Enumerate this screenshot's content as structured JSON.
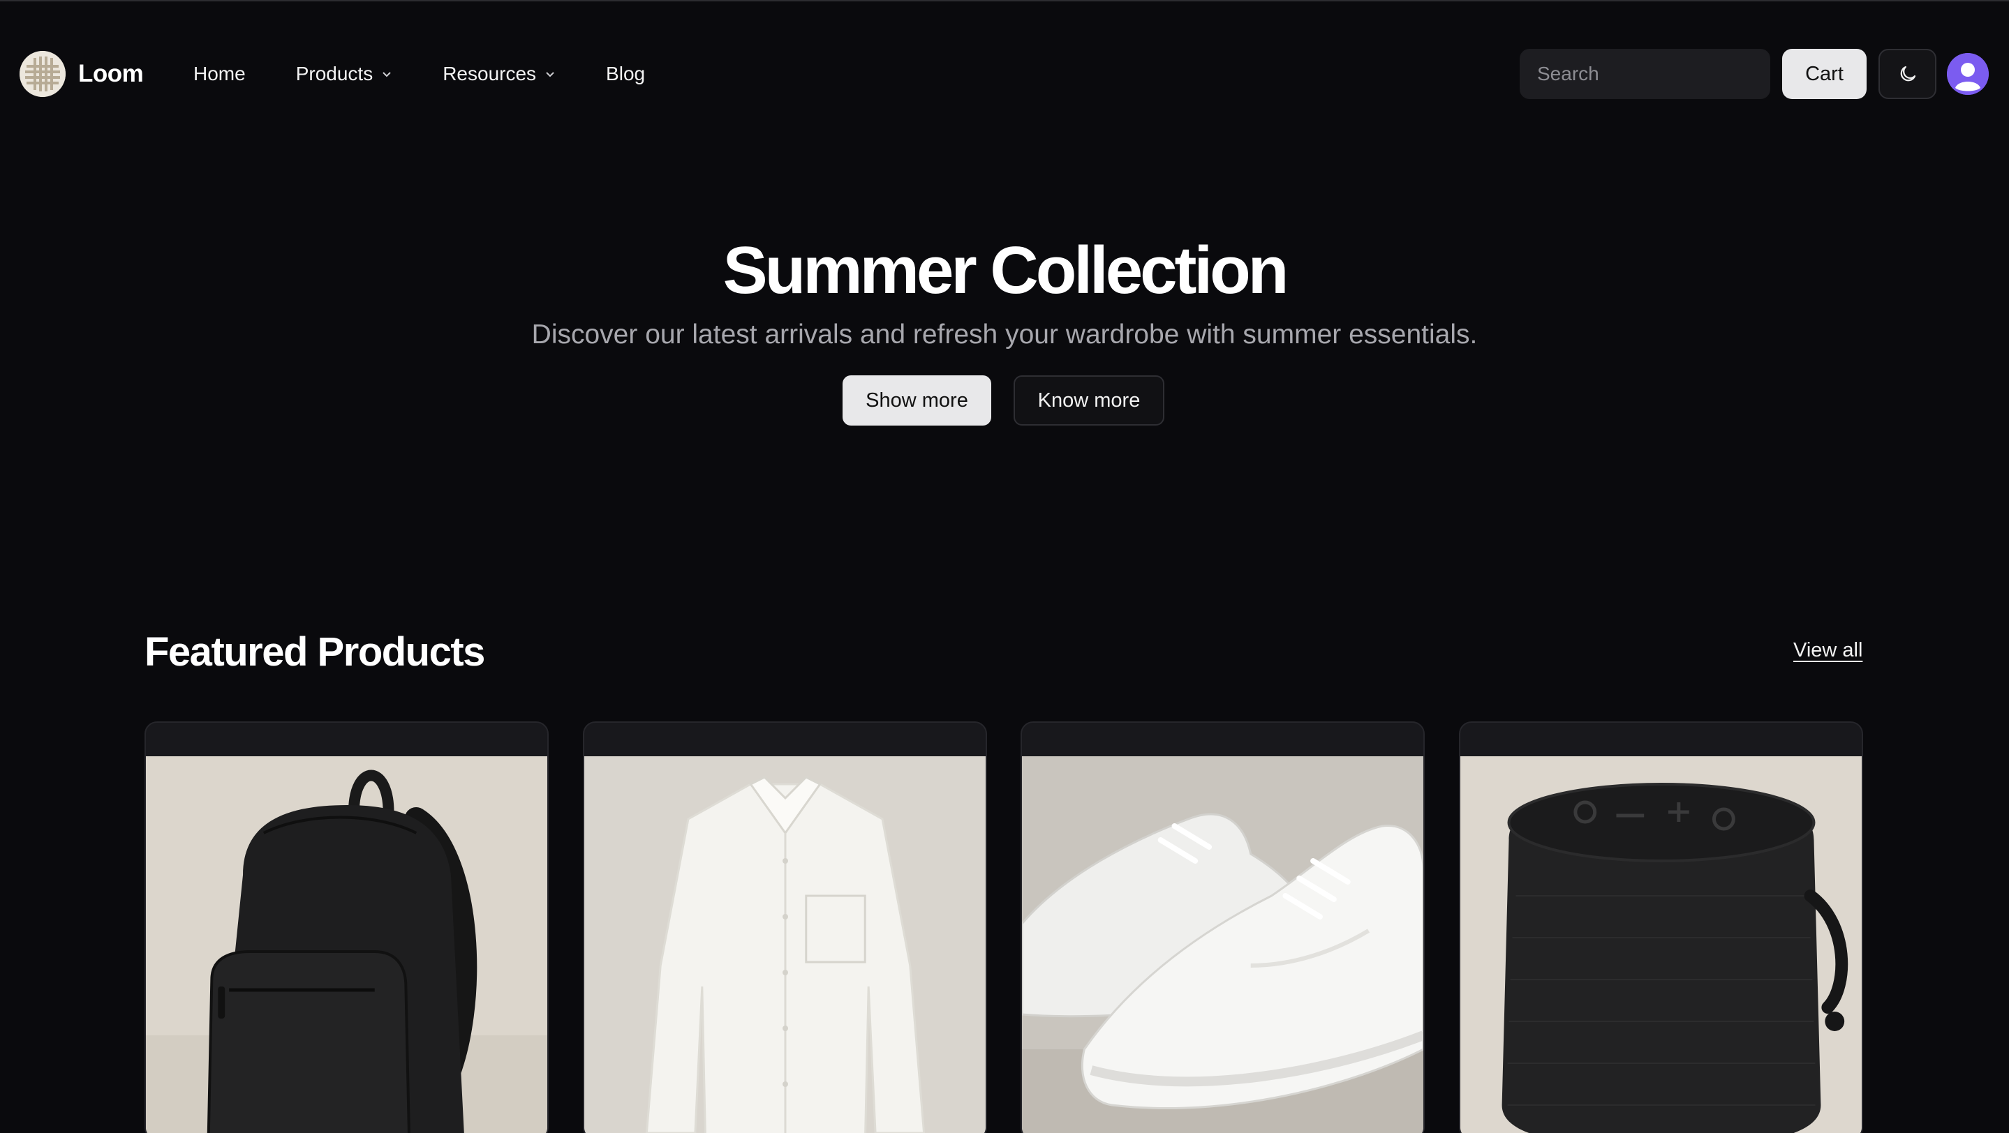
{
  "brand": {
    "name": "Loom"
  },
  "nav": {
    "items": [
      {
        "label": "Home"
      },
      {
        "label": "Products"
      },
      {
        "label": "Resources"
      },
      {
        "label": "Blog"
      }
    ]
  },
  "header": {
    "search_placeholder": "Search",
    "cart_label": "Cart",
    "theme_icon": "moon-icon",
    "avatar_icon": "user-icon"
  },
  "hero": {
    "title": "Summer Collection",
    "subtitle": "Discover our latest arrivals and refresh your wardrobe with summer essentials.",
    "primary_button": "Show more",
    "secondary_button": "Know more"
  },
  "featured": {
    "title": "Featured Products",
    "view_all": "View all",
    "products": [
      {
        "image": "backpack"
      },
      {
        "image": "white-shirt"
      },
      {
        "image": "white-sneakers"
      },
      {
        "image": "bluetooth-speaker"
      }
    ]
  },
  "colors": {
    "background": "#0a0a0d",
    "accent_avatar": "#7b5cf0",
    "button_light": "#e8e8ea"
  }
}
